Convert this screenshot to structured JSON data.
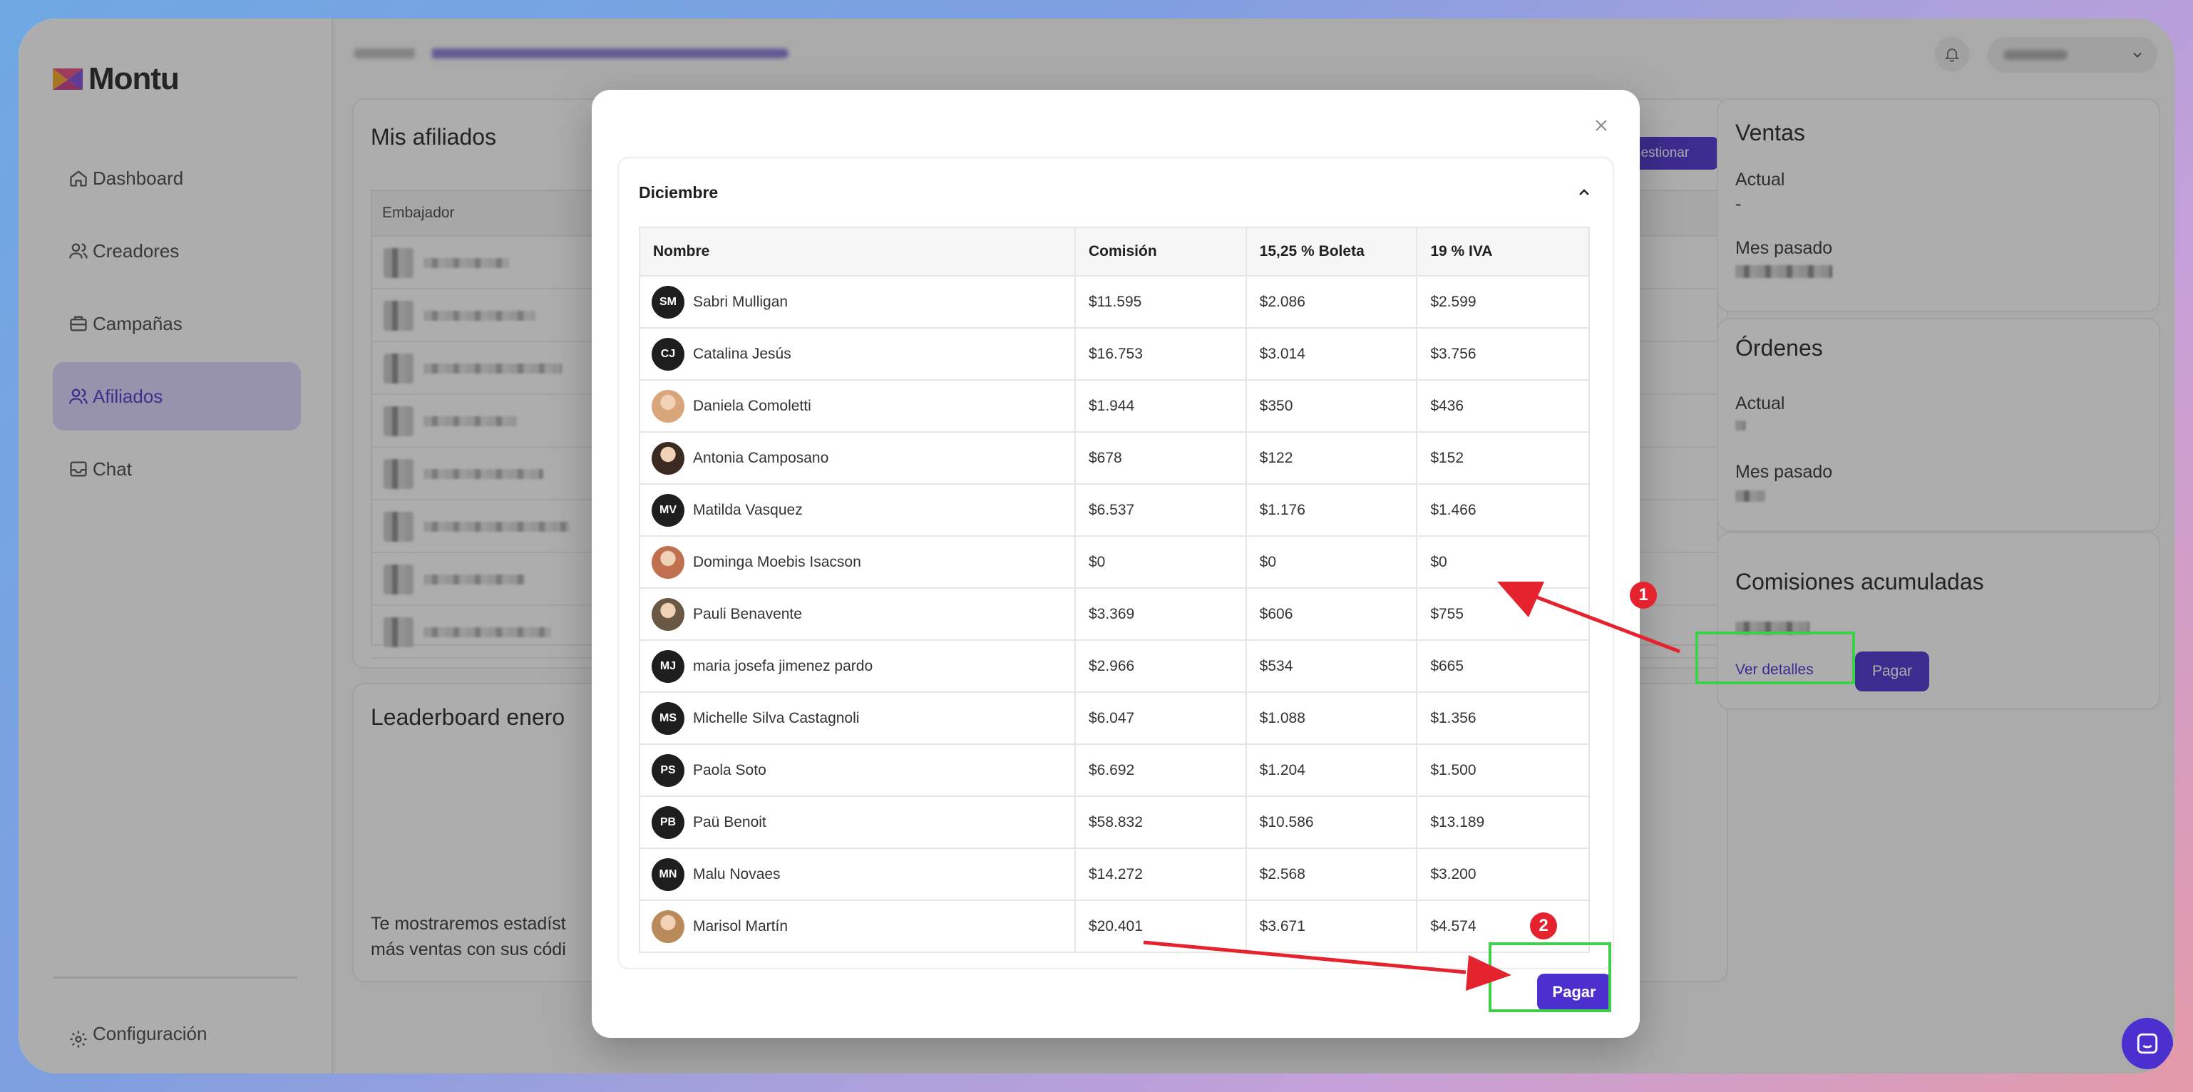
{
  "app": {
    "name": "Montu"
  },
  "sidebar": {
    "items": [
      {
        "label": "Dashboard",
        "icon": "home-icon"
      },
      {
        "label": "Creadores",
        "icon": "users-icon"
      },
      {
        "label": "Campañas",
        "icon": "briefcase-icon"
      },
      {
        "label": "Afiliados",
        "icon": "users-icon",
        "active": true
      },
      {
        "label": "Chat",
        "icon": "inbox-icon"
      }
    ],
    "config_label": "Configuración"
  },
  "affiliates": {
    "title": "Mis afiliados",
    "column_ambassador": "Embajador",
    "manage_label": "Gestionar"
  },
  "leaderboard": {
    "title": "Leaderboard enero",
    "text_line1": "Te mostraremos estadíst",
    "text_line2": "más ventas con sus códi"
  },
  "ventas": {
    "title": "Ventas",
    "actual_label": "Actual",
    "actual_value": "-",
    "last_label": "Mes pasado"
  },
  "ordenes": {
    "title": "Órdenes",
    "actual_label": "Actual",
    "last_label": "Mes pasado"
  },
  "comisiones": {
    "title": "Comisiones acumuladas",
    "details_label": "Ver detalles",
    "pay_label": "Pagar"
  },
  "modal": {
    "section_title": "Diciembre",
    "pay_label": "Pagar",
    "columns": [
      "Nombre",
      "Comisión",
      "15,25 % Boleta",
      "19 % IVA"
    ],
    "rows": [
      {
        "initials": "SM",
        "name": "Sabri Mulligan",
        "comision": "$11.595",
        "boleta": "$2.086",
        "iva": "$2.599",
        "photo": false
      },
      {
        "initials": "CJ",
        "name": "Catalina Jesús",
        "comision": "$16.753",
        "boleta": "$3.014",
        "iva": "$3.756",
        "photo": false
      },
      {
        "initials": "",
        "name": "Daniela Comoletti",
        "comision": "$1.944",
        "boleta": "$350",
        "iva": "$436",
        "photo": true,
        "color": "#d9a57a"
      },
      {
        "initials": "",
        "name": "Antonia Camposano",
        "comision": "$678",
        "boleta": "$122",
        "iva": "$152",
        "photo": true,
        "color": "#3a2a22"
      },
      {
        "initials": "MV",
        "name": "Matilda Vasquez",
        "comision": "$6.537",
        "boleta": "$1.176",
        "iva": "$1.466",
        "photo": false
      },
      {
        "initials": "",
        "name": "Dominga Moebis Isacson",
        "comision": "$0",
        "boleta": "$0",
        "iva": "$0",
        "photo": true,
        "color": "#c0704f"
      },
      {
        "initials": "",
        "name": "Pauli Benavente",
        "comision": "$3.369",
        "boleta": "$606",
        "iva": "$755",
        "photo": true,
        "color": "#6b5844"
      },
      {
        "initials": "MJ",
        "name": "maria josefa jimenez pardo",
        "comision": "$2.966",
        "boleta": "$534",
        "iva": "$665",
        "photo": false
      },
      {
        "initials": "MS",
        "name": "Michelle Silva Castagnoli",
        "comision": "$6.047",
        "boleta": "$1.088",
        "iva": "$1.356",
        "photo": false
      },
      {
        "initials": "PS",
        "name": "Paola Soto",
        "comision": "$6.692",
        "boleta": "$1.204",
        "iva": "$1.500",
        "photo": false
      },
      {
        "initials": "PB",
        "name": "Paü Benoit",
        "comision": "$58.832",
        "boleta": "$10.586",
        "iva": "$13.189",
        "photo": false
      },
      {
        "initials": "MN",
        "name": "Malu Novaes",
        "comision": "$14.272",
        "boleta": "$2.568",
        "iva": "$3.200",
        "photo": false
      },
      {
        "initials": "",
        "name": "Marisol Martín",
        "comision": "$20.401",
        "boleta": "$3.671",
        "iva": "$4.574",
        "photo": true,
        "color": "#b98a5a"
      }
    ]
  },
  "annotations": {
    "badge1": "1",
    "badge2": "2"
  },
  "colors": {
    "accent": "#4b2fcf",
    "highlight": "#3fd04a",
    "arrow": "#e5232e",
    "active_nav_bg": "#ddd5ff"
  }
}
